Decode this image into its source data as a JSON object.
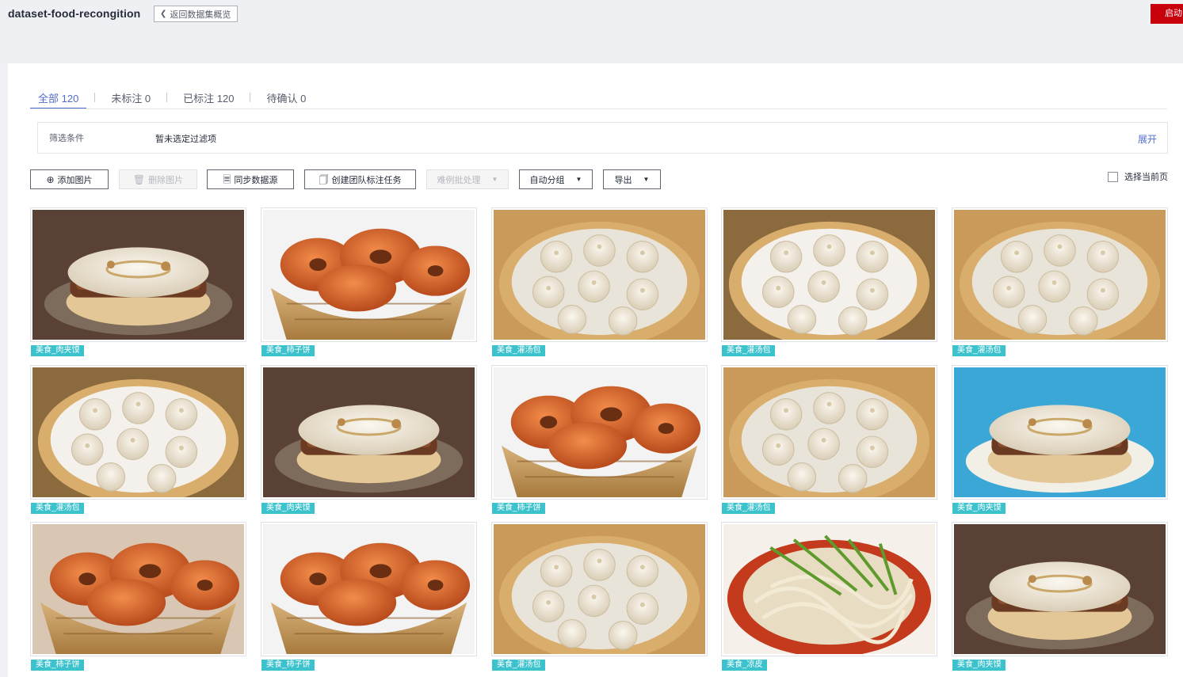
{
  "header": {
    "dataset_title": "dataset-food-recongition",
    "back_label": "返回数据集概览",
    "start_label": "启动"
  },
  "tabs": [
    {
      "label": "全部 120",
      "active": true
    },
    {
      "label": "未标注 0",
      "active": false
    },
    {
      "label": "已标注 120",
      "active": false
    },
    {
      "label": "待确认 0",
      "active": false
    }
  ],
  "filter": {
    "label": "筛选条件",
    "value": "暂未选定过滤项",
    "expand": "展开"
  },
  "toolbar": {
    "add_image": "添加图片",
    "delete_image": "删除图片",
    "sync_source": "同步数据源",
    "create_team_task": "创建团队标注任务",
    "hard_case": "难例批处理",
    "auto_group": "自动分组",
    "export": "导出",
    "select_page": "选择当前页"
  },
  "images": [
    {
      "label": "美食_肉夹馍",
      "kind": "roujiamo"
    },
    {
      "label": "美食_柿子饼",
      "kind": "shizibing"
    },
    {
      "label": "美食_灌汤包",
      "kind": "guantangbao"
    },
    {
      "label": "美食_灌汤包",
      "kind": "guantangbao"
    },
    {
      "label": "美食_灌汤包",
      "kind": "guantangbao"
    },
    {
      "label": "美食_灌汤包",
      "kind": "guantangbao"
    },
    {
      "label": "美食_肉夹馍",
      "kind": "roujiamo"
    },
    {
      "label": "美食_柿子饼",
      "kind": "shizibing"
    },
    {
      "label": "美食_灌汤包",
      "kind": "guantangbao"
    },
    {
      "label": "美食_肉夹馍",
      "kind": "roujiamo"
    },
    {
      "label": "美食_柿子饼",
      "kind": "shizibing"
    },
    {
      "label": "美食_柿子饼",
      "kind": "shizibing"
    },
    {
      "label": "美食_灌汤包",
      "kind": "guantangbao"
    },
    {
      "label": "美食_凉皮",
      "kind": "liangpi"
    },
    {
      "label": "美食_肉夹馍",
      "kind": "roujiamo"
    }
  ],
  "colors": {
    "accent": "#526ecc",
    "tag": "#3cc2cc",
    "danger": "#c7000b"
  }
}
